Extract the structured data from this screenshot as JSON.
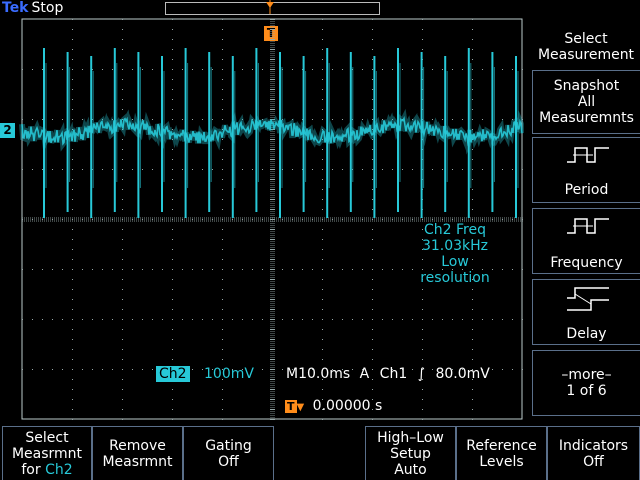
{
  "header": {
    "brand": "Tek",
    "state": "Stop"
  },
  "trigger_marker": "T",
  "channel_marker": "2",
  "measurement": {
    "line1": "Ch2 Freq",
    "line2": "31.03kHz",
    "line3": "Low",
    "line4": "resolution"
  },
  "status": {
    "channel": "Ch2",
    "volts_div": "100mV",
    "timebase": "M10.0ms",
    "mode": "A",
    "trig_source": "Ch1",
    "trig_level": "80.0mV",
    "trig_position": "0.00000 s"
  },
  "side_menu": {
    "title": [
      "Select",
      "Measurement"
    ],
    "snapshot": [
      "Snapshot",
      "All",
      "Measuremnts"
    ],
    "period": "Period",
    "frequency": "Frequency",
    "delay": "Delay",
    "more": [
      "–more–",
      "1 of 6"
    ]
  },
  "bottom_menu": {
    "select": [
      "Select",
      "Measrmnt",
      "for",
      "Ch2"
    ],
    "remove": [
      "Remove",
      "Measrmnt"
    ],
    "gating": [
      "Gating",
      "Off"
    ],
    "highlow": [
      "High–Low",
      "Setup",
      "Auto"
    ],
    "reference": [
      "Reference",
      "Levels"
    ],
    "indicators": [
      "Indicators",
      "Off"
    ]
  },
  "colors": {
    "trace": "#27c9d8",
    "trigger": "#ff8c1a",
    "grid": "#9aa",
    "frame": "#5a6f8a"
  }
}
